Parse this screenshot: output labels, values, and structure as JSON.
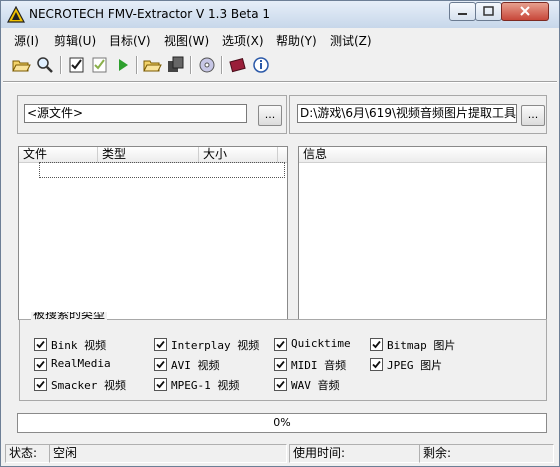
{
  "window": {
    "title": "NECROTECH FMV-Extractor V 1.3 Beta 1"
  },
  "menu": [
    "源(I)",
    "剪辑(U)",
    "目标(V)",
    "视图(W)",
    "选项(X)",
    "帮助(Y)",
    "测试(Z)"
  ],
  "toolbar_icons": [
    "open-folder-icon",
    "find-icon",
    "check-all-icon",
    "uncheck-icon",
    "play-icon",
    "open-target-icon",
    "copy-icon",
    "disc-icon",
    "books-icon",
    "info-icon"
  ],
  "source": {
    "value": "<源文件>",
    "browse_label": "..."
  },
  "target": {
    "value": "D:\\游戏\\6月\\619\\视频音频图片提取工具",
    "browse_label": "..."
  },
  "file_list": {
    "columns": [
      "文件",
      "类型",
      "大小"
    ]
  },
  "info_panel": {
    "header": "信息"
  },
  "section_label": "被搜索的类型",
  "checkboxes": [
    {
      "label": "Bink 视频",
      "checked": true
    },
    {
      "label": "Interplay 视频",
      "checked": true
    },
    {
      "label": "Quicktime",
      "checked": true
    },
    {
      "label": "Bitmap 图片",
      "checked": true
    },
    {
      "label": "RealMedia",
      "checked": true
    },
    {
      "label": "AVI 视频",
      "checked": true
    },
    {
      "label": "MIDI 音频",
      "checked": true
    },
    {
      "label": "JPEG 图片",
      "checked": true
    },
    {
      "label": "Smacker 视频",
      "checked": true
    },
    {
      "label": "MPEG-1 视频",
      "checked": true
    },
    {
      "label": "WAV 音频",
      "checked": true
    }
  ],
  "progress": {
    "value": 0,
    "text": "0%"
  },
  "status": {
    "state_label": "状态:",
    "state_value": "空闲",
    "elapsed_label": "使用时间:",
    "remaining_label": "剩余:"
  }
}
